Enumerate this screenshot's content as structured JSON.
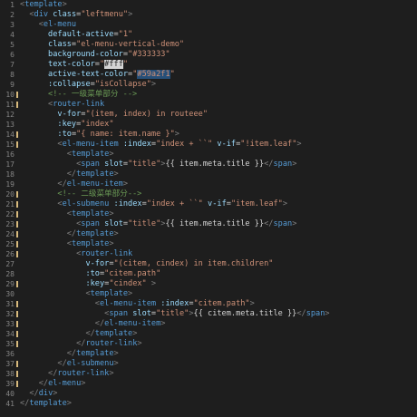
{
  "editor": {
    "lines": [
      {
        "n": "1",
        "segs": [
          [
            "punct",
            "<"
          ],
          [
            "tag",
            "template"
          ],
          [
            "punct",
            ">"
          ]
        ]
      },
      {
        "n": "2",
        "segs": [
          [
            "plain",
            "  "
          ],
          [
            "punct",
            "<"
          ],
          [
            "tag",
            "div"
          ],
          [
            "plain",
            " "
          ],
          [
            "attr",
            "class"
          ],
          [
            "plain",
            "="
          ],
          [
            "str",
            "\"leftmenu\""
          ],
          [
            "punct",
            ">"
          ]
        ]
      },
      {
        "n": "3",
        "segs": [
          [
            "plain",
            "    "
          ],
          [
            "punct",
            "<"
          ],
          [
            "tag",
            "el-menu"
          ]
        ]
      },
      {
        "n": "4",
        "segs": [
          [
            "plain",
            "      "
          ],
          [
            "attr",
            "default-active"
          ],
          [
            "plain",
            "="
          ],
          [
            "str",
            "\"1\""
          ]
        ]
      },
      {
        "n": "5",
        "segs": [
          [
            "plain",
            "      "
          ],
          [
            "attr",
            "class"
          ],
          [
            "plain",
            "="
          ],
          [
            "str",
            "\"el-menu-vertical-demo\""
          ]
        ]
      },
      {
        "n": "6",
        "segs": [
          [
            "plain",
            "      "
          ],
          [
            "attr",
            "background-color"
          ],
          [
            "plain",
            "="
          ],
          [
            "str",
            "\"#333333\""
          ]
        ]
      },
      {
        "n": "7",
        "segs": [
          [
            "plain",
            "      "
          ],
          [
            "attr",
            "text-color"
          ],
          [
            "plain",
            "="
          ],
          [
            "str",
            "\""
          ],
          [
            "hlc",
            "#fff"
          ],
          [
            "str",
            "\""
          ]
        ]
      },
      {
        "n": "8",
        "segs": [
          [
            "plain",
            "      "
          ],
          [
            "attr",
            "active-text-color"
          ],
          [
            "plain",
            "="
          ],
          [
            "str",
            "\""
          ],
          [
            "hl",
            "#59a2f1"
          ],
          [
            "str",
            "\""
          ]
        ]
      },
      {
        "n": "9",
        "segs": [
          [
            "plain",
            "      "
          ],
          [
            "attr",
            ":collapse"
          ],
          [
            "plain",
            "="
          ],
          [
            "str",
            "\"isCollapse\""
          ],
          [
            "punct",
            ">"
          ]
        ]
      },
      {
        "n": "10",
        "segs": [
          [
            "plain",
            "      "
          ],
          [
            "cmt",
            "<!-- 一级菜单部分 -->"
          ]
        ]
      },
      {
        "n": "11",
        "segs": [
          [
            "plain",
            "      "
          ],
          [
            "punct",
            "<"
          ],
          [
            "tag",
            "router-link"
          ]
        ]
      },
      {
        "n": "12",
        "segs": [
          [
            "plain",
            "        "
          ],
          [
            "attr",
            "v-for"
          ],
          [
            "plain",
            "="
          ],
          [
            "str",
            "\"(item, index) in routeee\""
          ]
        ]
      },
      {
        "n": "13",
        "segs": [
          [
            "plain",
            "        "
          ],
          [
            "attr",
            ":key"
          ],
          [
            "plain",
            "="
          ],
          [
            "str",
            "\"index\""
          ]
        ]
      },
      {
        "n": "14",
        "segs": [
          [
            "plain",
            "        "
          ],
          [
            "attr",
            ":to"
          ],
          [
            "plain",
            "="
          ],
          [
            "str",
            "\"{ name: item.name }\""
          ],
          [
            "punct",
            ">"
          ]
        ]
      },
      {
        "n": "15",
        "segs": [
          [
            "plain",
            "        "
          ],
          [
            "punct",
            "<"
          ],
          [
            "tag",
            "el-menu-item"
          ],
          [
            "plain",
            " "
          ],
          [
            "attr",
            ":index"
          ],
          [
            "plain",
            "="
          ],
          [
            "str",
            "\"index + ``\""
          ],
          [
            "plain",
            " "
          ],
          [
            "attr",
            "v-if"
          ],
          [
            "plain",
            "="
          ],
          [
            "str",
            "\"!item.leaf\""
          ],
          [
            "punct",
            ">"
          ]
        ]
      },
      {
        "n": "16",
        "segs": [
          [
            "plain",
            "          "
          ],
          [
            "punct",
            "<"
          ],
          [
            "tag",
            "template"
          ],
          [
            "punct",
            ">"
          ]
        ]
      },
      {
        "n": "17",
        "segs": [
          [
            "plain",
            "            "
          ],
          [
            "punct",
            "<"
          ],
          [
            "tag",
            "span"
          ],
          [
            "plain",
            " "
          ],
          [
            "attr",
            "slot"
          ],
          [
            "plain",
            "="
          ],
          [
            "str",
            "\"title\""
          ],
          [
            "punct",
            ">"
          ],
          [
            "plain",
            "{{ item.meta.title }}"
          ],
          [
            "punct",
            "</"
          ],
          [
            "tag",
            "span"
          ],
          [
            "punct",
            ">"
          ]
        ]
      },
      {
        "n": "18",
        "segs": [
          [
            "plain",
            "          "
          ],
          [
            "punct",
            "</"
          ],
          [
            "tag",
            "template"
          ],
          [
            "punct",
            ">"
          ]
        ]
      },
      {
        "n": "19",
        "segs": [
          [
            "plain",
            "        "
          ],
          [
            "punct",
            "</"
          ],
          [
            "tag",
            "el-menu-item"
          ],
          [
            "punct",
            ">"
          ]
        ]
      },
      {
        "n": "20",
        "segs": [
          [
            "plain",
            "        "
          ],
          [
            "cmt",
            "<!-- 二级菜单部分-->"
          ]
        ]
      },
      {
        "n": "21",
        "segs": [
          [
            "plain",
            "        "
          ],
          [
            "punct",
            "<"
          ],
          [
            "tag",
            "el-submenu"
          ],
          [
            "plain",
            " "
          ],
          [
            "attr",
            ":index"
          ],
          [
            "plain",
            "="
          ],
          [
            "str",
            "\"index + ``\""
          ],
          [
            "plain",
            " "
          ],
          [
            "attr",
            "v-if"
          ],
          [
            "plain",
            "="
          ],
          [
            "str",
            "\"item.leaf\""
          ],
          [
            "punct",
            ">"
          ]
        ]
      },
      {
        "n": "22",
        "segs": [
          [
            "plain",
            "          "
          ],
          [
            "punct",
            "<"
          ],
          [
            "tag",
            "template"
          ],
          [
            "punct",
            ">"
          ]
        ]
      },
      {
        "n": "23",
        "segs": [
          [
            "plain",
            "            "
          ],
          [
            "punct",
            "<"
          ],
          [
            "tag",
            "span"
          ],
          [
            "plain",
            " "
          ],
          [
            "attr",
            "slot"
          ],
          [
            "plain",
            "="
          ],
          [
            "str",
            "\"title\""
          ],
          [
            "punct",
            ">"
          ],
          [
            "plain",
            "{{ item.meta.title }}"
          ],
          [
            "punct",
            "</"
          ],
          [
            "tag",
            "span"
          ],
          [
            "punct",
            ">"
          ]
        ]
      },
      {
        "n": "24",
        "segs": [
          [
            "plain",
            "          "
          ],
          [
            "punct",
            "</"
          ],
          [
            "tag",
            "template"
          ],
          [
            "punct",
            ">"
          ]
        ]
      },
      {
        "n": "25",
        "segs": [
          [
            "plain",
            "          "
          ],
          [
            "punct",
            "<"
          ],
          [
            "tag",
            "template"
          ],
          [
            "punct",
            ">"
          ]
        ]
      },
      {
        "n": "26",
        "segs": [
          [
            "plain",
            "            "
          ],
          [
            "punct",
            "<"
          ],
          [
            "tag",
            "router-link"
          ]
        ]
      },
      {
        "n": "27",
        "segs": [
          [
            "plain",
            "              "
          ],
          [
            "attr",
            "v-for"
          ],
          [
            "plain",
            "="
          ],
          [
            "str",
            "\"(citem, cindex) in item.children\""
          ]
        ]
      },
      {
        "n": "28",
        "segs": [
          [
            "plain",
            "              "
          ],
          [
            "attr",
            ":to"
          ],
          [
            "plain",
            "="
          ],
          [
            "str",
            "\"citem.path\""
          ]
        ]
      },
      {
        "n": "29",
        "segs": [
          [
            "plain",
            "              "
          ],
          [
            "attr",
            ":key"
          ],
          [
            "plain",
            "="
          ],
          [
            "str",
            "\"cindex\""
          ],
          [
            "plain",
            " "
          ],
          [
            "punct",
            ">"
          ]
        ]
      },
      {
        "n": "30",
        "segs": [
          [
            "plain",
            "              "
          ],
          [
            "punct",
            "<"
          ],
          [
            "tag",
            "template"
          ],
          [
            "punct",
            ">"
          ]
        ]
      },
      {
        "n": "31",
        "segs": [
          [
            "plain",
            "                "
          ],
          [
            "punct",
            "<"
          ],
          [
            "tag",
            "el-menu-item"
          ],
          [
            "plain",
            " "
          ],
          [
            "attr",
            ":index"
          ],
          [
            "plain",
            "="
          ],
          [
            "str",
            "\"citem.path\""
          ],
          [
            "punct",
            ">"
          ]
        ]
      },
      {
        "n": "32",
        "segs": [
          [
            "plain",
            "                  "
          ],
          [
            "punct",
            "<"
          ],
          [
            "tag",
            "span"
          ],
          [
            "plain",
            " "
          ],
          [
            "attr",
            "slot"
          ],
          [
            "plain",
            "="
          ],
          [
            "str",
            "\"title\""
          ],
          [
            "punct",
            ">"
          ],
          [
            "plain",
            "{{ citem.meta.title }}"
          ],
          [
            "punct",
            "</"
          ],
          [
            "tag",
            "span"
          ],
          [
            "punct",
            ">"
          ]
        ]
      },
      {
        "n": "33",
        "segs": [
          [
            "plain",
            "                "
          ],
          [
            "punct",
            "</"
          ],
          [
            "tag",
            "el-menu-item"
          ],
          [
            "punct",
            ">"
          ]
        ]
      },
      {
        "n": "34",
        "segs": [
          [
            "plain",
            "              "
          ],
          [
            "punct",
            "</"
          ],
          [
            "tag",
            "template"
          ],
          [
            "punct",
            ">"
          ]
        ]
      },
      {
        "n": "35",
        "segs": [
          [
            "plain",
            "            "
          ],
          [
            "punct",
            "</"
          ],
          [
            "tag",
            "router-link"
          ],
          [
            "punct",
            ">"
          ]
        ]
      },
      {
        "n": "36",
        "segs": [
          [
            "plain",
            "          "
          ],
          [
            "punct",
            "</"
          ],
          [
            "tag",
            "template"
          ],
          [
            "punct",
            ">"
          ]
        ]
      },
      {
        "n": "37",
        "segs": [
          [
            "plain",
            "        "
          ],
          [
            "punct",
            "</"
          ],
          [
            "tag",
            "el-submenu"
          ],
          [
            "punct",
            ">"
          ]
        ]
      },
      {
        "n": "38",
        "segs": [
          [
            "plain",
            "      "
          ],
          [
            "punct",
            "</"
          ],
          [
            "tag",
            "router-link"
          ],
          [
            "punct",
            ">"
          ]
        ]
      },
      {
        "n": "39",
        "segs": [
          [
            "plain",
            "    "
          ],
          [
            "punct",
            "</"
          ],
          [
            "tag",
            "el-menu"
          ],
          [
            "punct",
            ">"
          ]
        ]
      },
      {
        "n": "40",
        "segs": [
          [
            "plain",
            "  "
          ],
          [
            "punct",
            "</"
          ],
          [
            "tag",
            "div"
          ],
          [
            "punct",
            ">"
          ]
        ]
      },
      {
        "n": "41",
        "segs": [
          [
            "punct",
            "</"
          ],
          [
            "tag",
            "template"
          ],
          [
            "punct",
            ">"
          ]
        ]
      }
    ]
  },
  "colors": {
    "background": "#1e1e1e",
    "tag": "#569cd6",
    "attribute": "#9cdcfe",
    "string": "#ce9178",
    "comment": "#6a9955",
    "gutter": "#858585",
    "modified_marker": "#d7ba7d"
  }
}
